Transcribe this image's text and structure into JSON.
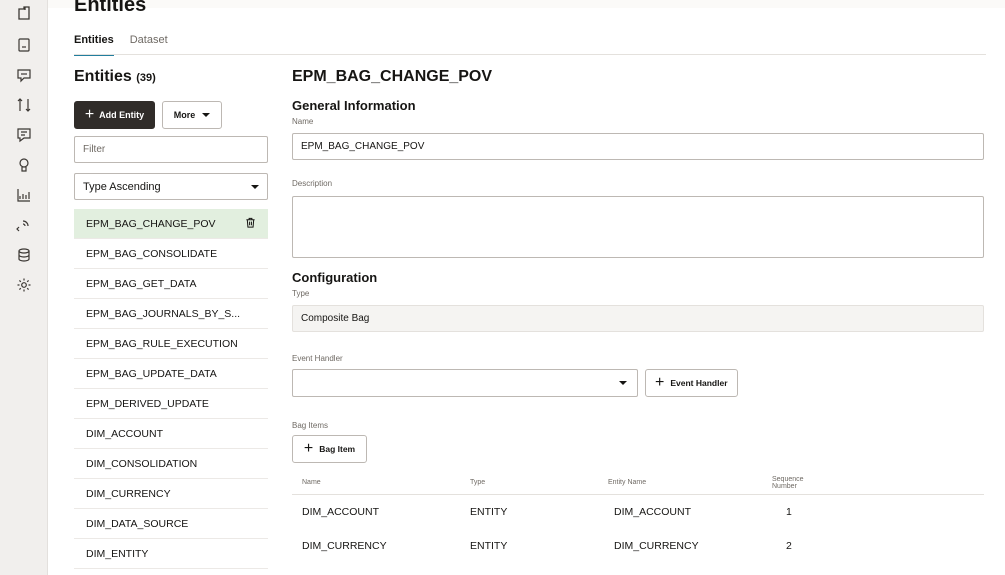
{
  "rail": {
    "icons": [
      "entities-icon",
      "intents-icon",
      "chat-icon",
      "resource-icon",
      "flows-icon",
      "insights-icon",
      "analytics-icon",
      "channels-icon",
      "data-icon",
      "settings-icon"
    ]
  },
  "page": {
    "heading": "Entities",
    "tabs": [
      {
        "label": "Entities",
        "active": true
      },
      {
        "label": "Dataset",
        "active": false
      }
    ]
  },
  "left": {
    "title": "Entities",
    "count": "(39)",
    "add_label": "Add Entity",
    "more_label": "More",
    "filter_placeholder": "Filter",
    "sort_value": "Type Ascending",
    "entities": [
      "EPM_BAG_CHANGE_POV",
      "EPM_BAG_CONSOLIDATE",
      "EPM_BAG_GET_DATA",
      "EPM_BAG_JOURNALS_BY_S...",
      "EPM_BAG_RULE_EXECUTION",
      "EPM_BAG_UPDATE_DATA",
      "EPM_DERIVED_UPDATE",
      "DIM_ACCOUNT",
      "DIM_CONSOLIDATION",
      "DIM_CURRENCY",
      "DIM_DATA_SOURCE",
      "DIM_ENTITY"
    ]
  },
  "detail": {
    "title": "EPM_BAG_CHANGE_POV",
    "general_heading": "General Information",
    "name_label": "Name",
    "name_value": "EPM_BAG_CHANGE_POV",
    "description_label": "Description",
    "config_heading": "Configuration",
    "type_label": "Type",
    "type_value": "Composite Bag",
    "event_handler_label": "Event Handler",
    "event_handler_button": "Event Handler",
    "bag_items_label": "Bag Items",
    "bag_item_button": "Bag Item",
    "columns": {
      "name": "Name",
      "type": "Type",
      "entity_name": "Entity Name",
      "sequence_1": "Sequence",
      "sequence_2": "Number"
    },
    "rows": [
      {
        "name": "DIM_ACCOUNT",
        "type": "ENTITY",
        "entity_name": "DIM_ACCOUNT",
        "sequence": "1"
      },
      {
        "name": "DIM_CURRENCY",
        "type": "ENTITY",
        "entity_name": "DIM_CURRENCY",
        "sequence": "2"
      }
    ]
  }
}
